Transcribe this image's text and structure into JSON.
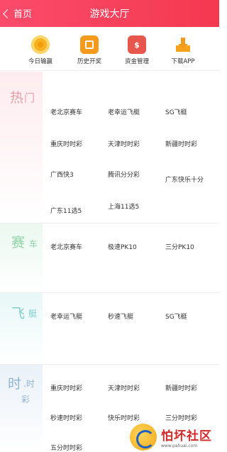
{
  "header": {
    "back_label": "首页",
    "title": "游戏大厅"
  },
  "quick": [
    {
      "label": "今日输赢",
      "icon": "coin-icon"
    },
    {
      "label": "历史开奖",
      "icon": "history-icon"
    },
    {
      "label": "资金管理",
      "icon": "money-icon",
      "glyph": "$"
    },
    {
      "label": "下载APP",
      "icon": "download-icon"
    }
  ],
  "sections": {
    "hot": {
      "big": "热",
      "small": "门",
      "color": "#e8a0a8",
      "items": [
        "老北京赛车",
        "老幸运飞艇",
        "SG飞艇",
        "重庆时时彩",
        "天津时时彩",
        "新疆时时彩",
        "广西快3",
        "腾讯分分彩",
        "广东快乐十分",
        "广东11选5",
        "上海11选5"
      ]
    },
    "race": {
      "big": "赛",
      "small": "车",
      "color": "#8fd4a8",
      "items": [
        "老北京赛车",
        "极速PK10",
        "三分PK10"
      ]
    },
    "boat": {
      "big": "飞",
      "small": "艇",
      "color": "#7fd0cf",
      "items": [
        "老幸运飞艇",
        "秒速飞艇",
        "SG飞艇"
      ]
    },
    "ssc": {
      "big": "时",
      "small": ".时",
      "small2": "彩",
      "color": "#8fb3d6",
      "items": [
        "重庆时时彩",
        "天津时时彩",
        "新疆时时彩",
        "秒速时时彩",
        "快乐时时彩",
        "三分时时彩",
        "五分时时彩"
      ]
    }
  },
  "watermark": {
    "title": "怕坏社区",
    "url": "www.pahuai.com"
  }
}
